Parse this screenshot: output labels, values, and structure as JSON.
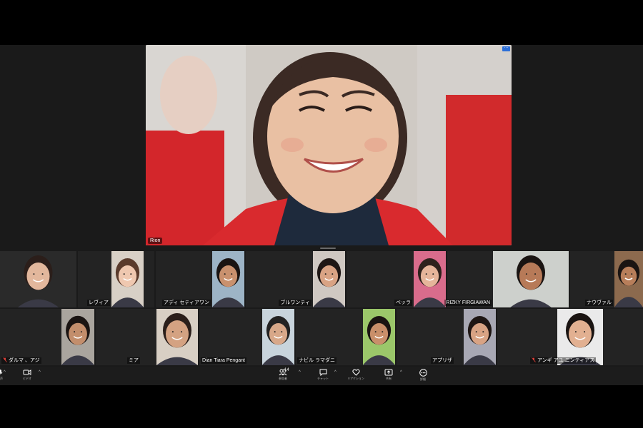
{
  "speaker": {
    "name": "Rion"
  },
  "gallery": {
    "row1": [
      {
        "name": "",
        "mute": false
      },
      {
        "name": "レヴィア",
        "mute": false
      },
      {
        "name": "アディ セティアワン",
        "mute": false
      },
      {
        "name": "ブルワンティ",
        "mute": false
      },
      {
        "name": "ベッラ",
        "mute": false
      },
      {
        "name": "RIZKY FIRGIAWAN",
        "mute": false
      },
      {
        "name": "ナウヴァル",
        "mute": false
      }
    ],
    "row2": [
      {
        "name": "ダルマ 、アジ",
        "mute": true
      },
      {
        "name": "ミア",
        "mute": false
      },
      {
        "name": "Dian Tiara Pengant",
        "mute": false
      },
      {
        "name": "ナビル ラマダニ",
        "mute": false
      },
      {
        "name": "アプリザ",
        "mute": false
      },
      {
        "name": "アンギ アユ ニンティアス",
        "mute": true
      }
    ]
  },
  "toolbar": {
    "participant_count": "14",
    "items": [
      {
        "label": "音声",
        "icon": "microphone-icon"
      },
      {
        "label": "ビデオ",
        "icon": "video-camera-icon"
      },
      {
        "label": "参加者",
        "icon": "participants-icon"
      },
      {
        "label": "チャット",
        "icon": "chat-icon"
      },
      {
        "label": "リアクション",
        "icon": "reaction-heart-icon"
      },
      {
        "label": "共有",
        "icon": "share-screen-icon"
      },
      {
        "label": "詳細",
        "icon": "more-icon"
      }
    ]
  },
  "colors": {
    "background": "#1a1a1a",
    "tile": "#232323",
    "accent": "#2d6fd8",
    "mute": "#e0413a"
  }
}
